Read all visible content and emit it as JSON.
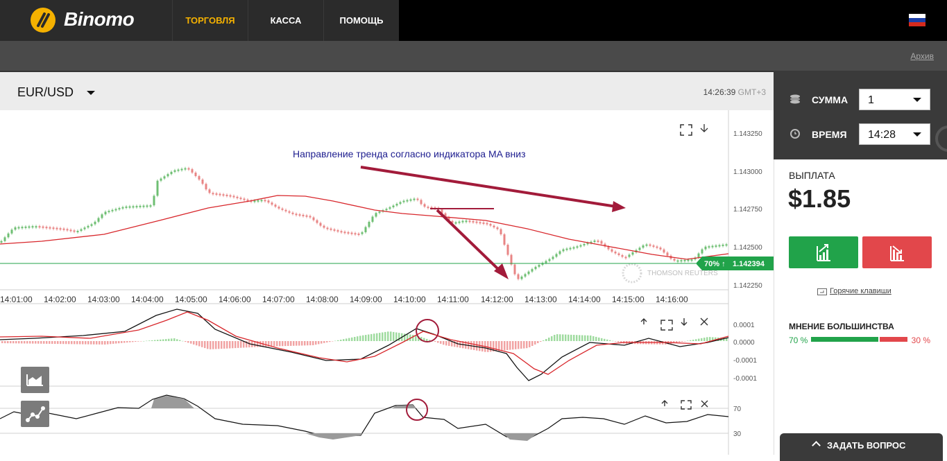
{
  "header": {
    "brand": "Binomo",
    "nav": [
      {
        "label": "ТОРГОВЛЯ",
        "active": true
      },
      {
        "label": "КАССА",
        "active": false
      },
      {
        "label": "ПОМОЩЬ",
        "active": false
      }
    ],
    "language_flag": "russia-flag"
  },
  "subbar": {
    "archive_link": "Архив"
  },
  "chart": {
    "pair": "EUR/USD",
    "time": "14:26:39",
    "timezone": "GMT+3",
    "annotation": "Направление тренда согласно индикатора MA вниз",
    "price_ticks": [
      "1.143250",
      "1.143000",
      "1.142750",
      "1.142500",
      "1.142250"
    ],
    "current_price": "1.142394",
    "current_tag": "70% ↑",
    "watermark": "THOMSON REUTERS",
    "time_ticks": [
      "14:01:00",
      "14:02:00",
      "14:03:00",
      "14:04:00",
      "14:05:00",
      "14:06:00",
      "14:07:00",
      "14:08:00",
      "14:09:00",
      "14:10:00",
      "14:11:00",
      "14:12:00",
      "14:13:00",
      "14:14:00",
      "14:15:00",
      "14:16:00"
    ],
    "macd_ticks": [
      "0.0001",
      "0.0000",
      "-0.0001",
      "-0.0001"
    ],
    "rsi_ticks": [
      "70",
      "30"
    ],
    "colors": {
      "up": "#6fbf73",
      "down": "#e88585",
      "ma": "#d8262b",
      "current": "#21a34a"
    }
  },
  "trade": {
    "amount_label": "СУММА",
    "amount_value": "1",
    "time_label": "ВРЕМЯ",
    "time_value": "14:28",
    "payout_label": "ВЫПЛАТА",
    "payout_value": "$1.85",
    "hotkeys": "Горячие клавиши",
    "majority_label": "МНЕНИЕ БОЛЬШИНСТВА",
    "majority_up": "70 %",
    "majority_down": "30 %",
    "majority_up_fraction": 0.7
  },
  "ask_button": "ЗАДАТЬ ВОПРОС"
}
